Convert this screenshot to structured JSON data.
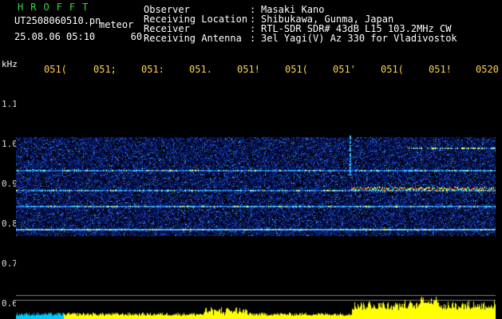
{
  "header": {
    "brand": "HROFFT",
    "filename": "UT2508060510.pn",
    "mode": "meteor",
    "datetime": "25.08.06 05:10",
    "interval": "60."
  },
  "meta": [
    {
      "label": "Observer",
      "value": "Masaki Kano"
    },
    {
      "label": "Receiving Location",
      "value": "Shibukawa, Gunma, Japan"
    },
    {
      "label": "Receiver",
      "value": "RTL-SDR SDR# 43dB L15 103.2MHz CW"
    },
    {
      "label": "Receiving Antenna",
      "value": "3el Yagi(V) Az 330 for Vladivostok"
    }
  ],
  "time_axis": {
    "labels": [
      "051(",
      "051;",
      "051:",
      "051.",
      "051!",
      "051(",
      "051'",
      "051(",
      "051!",
      "0520"
    ]
  },
  "freq_axis": {
    "unit": "kHz",
    "ticks": [
      "1.1",
      "1.0",
      "0.9",
      "0.8",
      "0.7",
      "0.6"
    ]
  },
  "colors": {
    "background": "#000000",
    "text": "#ffffff",
    "brand": "#33dd33",
    "time_label": "#ffd34d",
    "noise_base": "#0a1a7a",
    "echo_hot": "#ff3030",
    "echo_warm": "#ffff40",
    "meter": "#ffff00"
  }
}
